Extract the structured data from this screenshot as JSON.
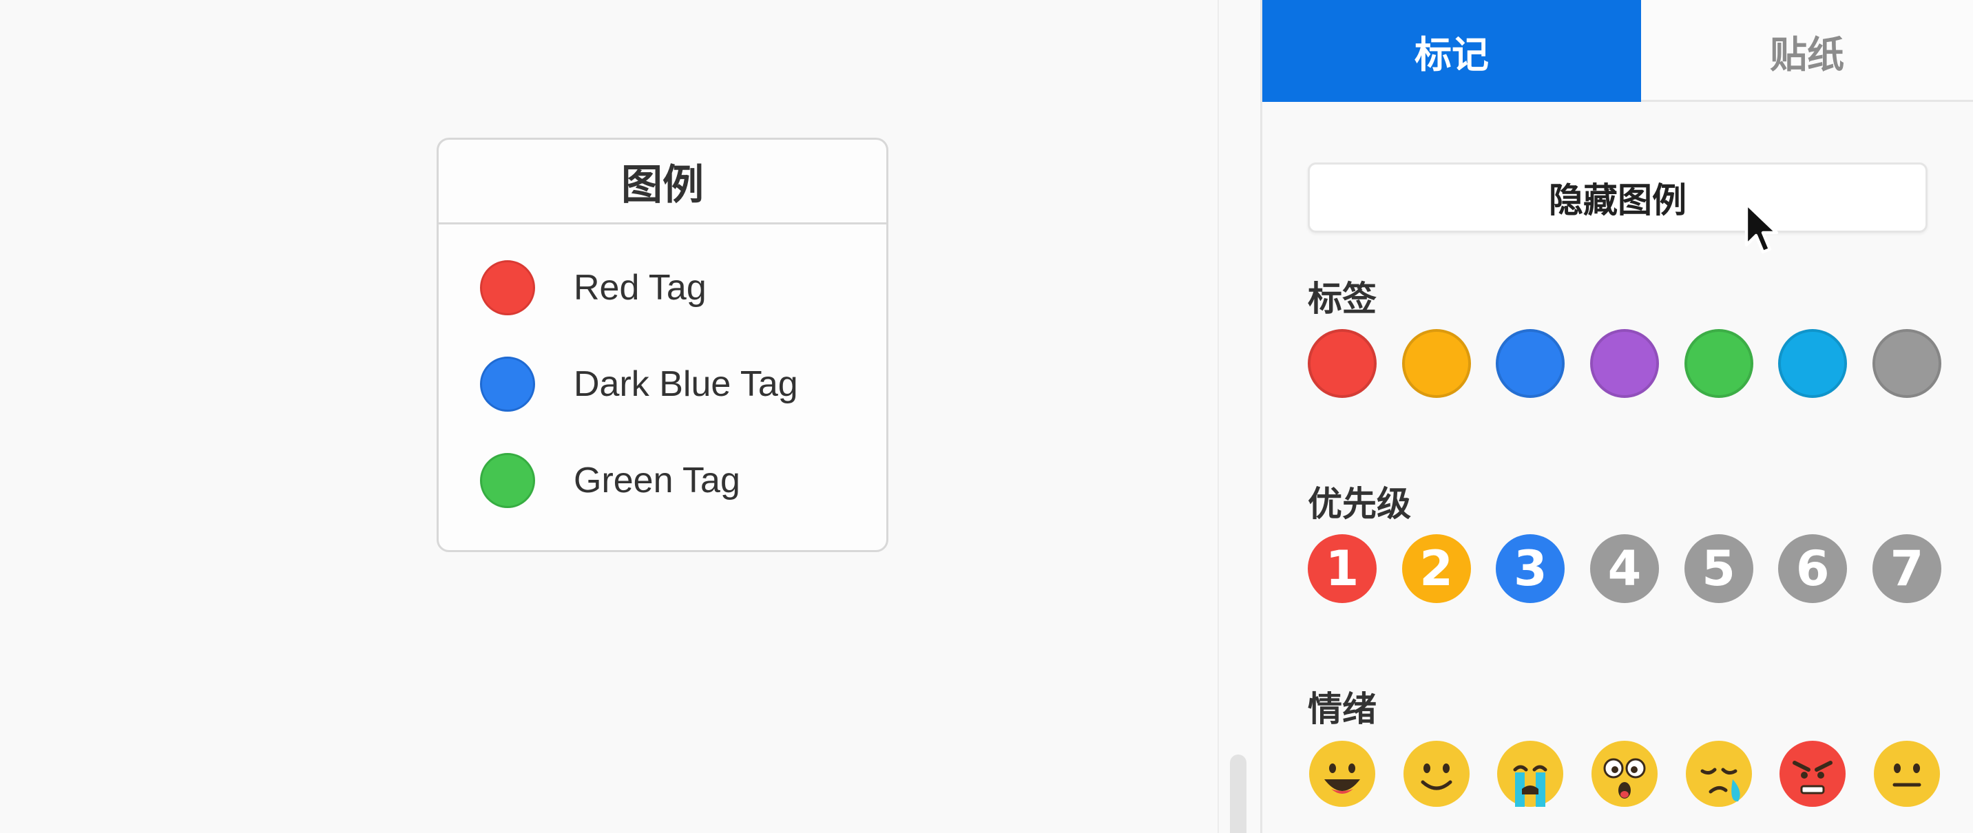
{
  "legend": {
    "title": "图例",
    "items": [
      {
        "label": "Red Tag",
        "color": "#f2453d",
        "border": "#d93a33"
      },
      {
        "label": "Dark Blue Tag",
        "color": "#2b7ff0",
        "border": "#1f6ad2"
      },
      {
        "label": "Green Tag",
        "color": "#45c550",
        "border": "#36ad41"
      }
    ]
  },
  "panel": {
    "tabs": [
      {
        "label": "标记",
        "active": true
      },
      {
        "label": "贴纸",
        "active": false
      }
    ],
    "hide_legend_button": "隐藏图例",
    "sections": {
      "tags": {
        "label": "标签",
        "colors": [
          "#f2453d",
          "#fbb010",
          "#2b7ff0",
          "#a55bd5",
          "#45c550",
          "#13a9e6",
          "#999999"
        ]
      },
      "priority": {
        "label": "优先级",
        "items": [
          {
            "number": "1",
            "color": "#f2453d"
          },
          {
            "number": "2",
            "color": "#fbb010"
          },
          {
            "number": "3",
            "color": "#2b7ff0"
          },
          {
            "number": "4",
            "color": "#9b9b9b"
          },
          {
            "number": "5",
            "color": "#9b9b9b"
          },
          {
            "number": "6",
            "color": "#9b9b9b"
          },
          {
            "number": "7",
            "color": "#9b9b9b"
          }
        ]
      },
      "emotion": {
        "label": "情绪",
        "icons": [
          "grinning-face-icon",
          "smiling-face-icon",
          "crying-face-icon",
          "astonished-face-icon",
          "sad-tear-face-icon",
          "angry-face-icon",
          "neutral-face-icon"
        ]
      }
    }
  }
}
